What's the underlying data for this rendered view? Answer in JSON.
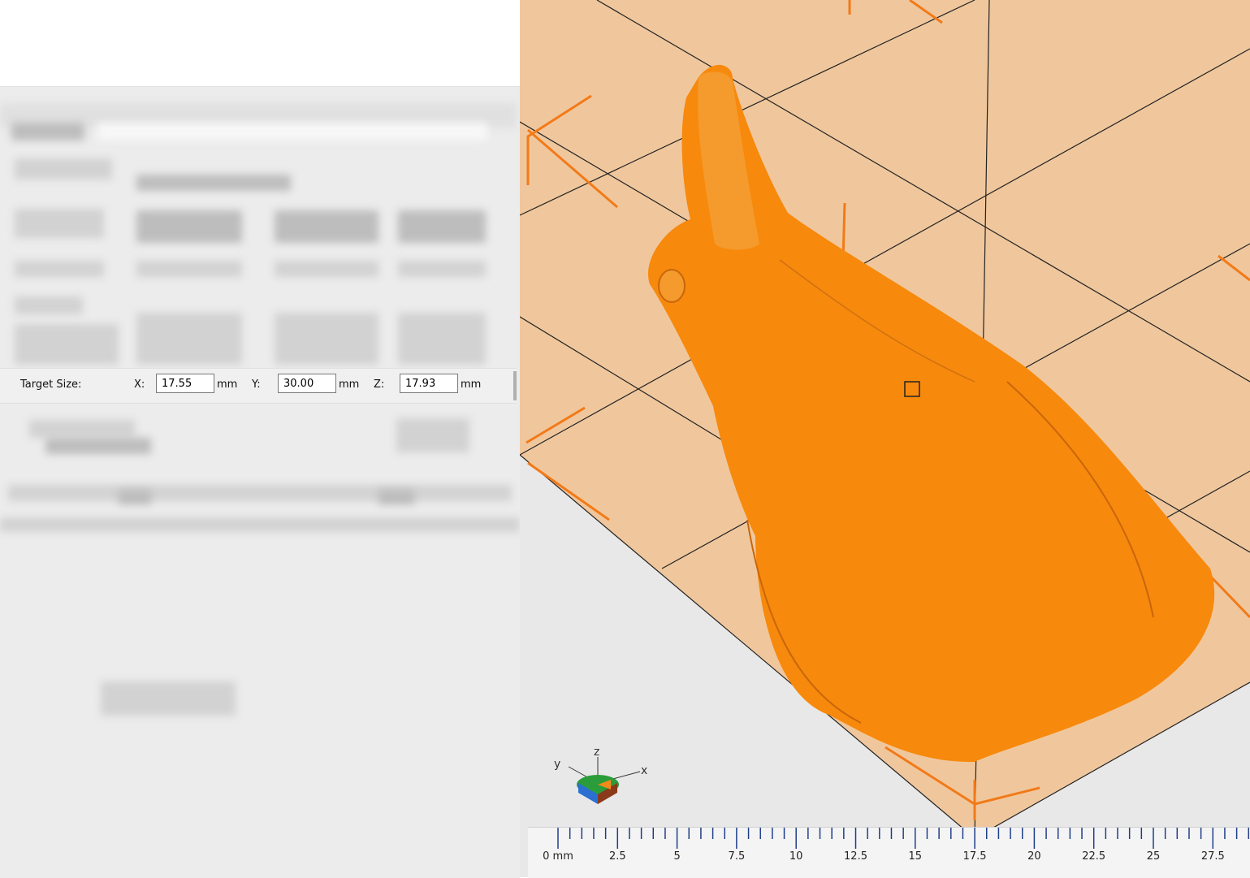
{
  "dialog": {
    "target_size": {
      "label": "Target Size:",
      "x_label": "X:",
      "x_value": "17.55",
      "y_label": "Y:",
      "y_value": "30.00",
      "z_label": "Z:",
      "z_value": "17.93",
      "unit": "mm"
    }
  },
  "viewport": {
    "axes": {
      "x": "x",
      "y": "y",
      "z": "z"
    },
    "model_color": "#f7890c",
    "bed_color": "#f0c79d",
    "ruler": {
      "labels": [
        "0 mm",
        "2.5",
        "5",
        "7.5",
        "10",
        "12.5",
        "15",
        "17.5",
        "20",
        "22.5",
        "25",
        "27.5"
      ]
    }
  }
}
